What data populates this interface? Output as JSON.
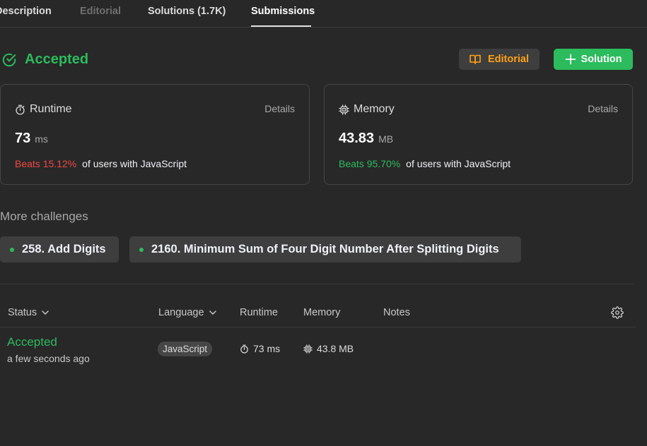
{
  "tabs": [
    {
      "label": "Description"
    },
    {
      "label": "Editorial"
    },
    {
      "label": "Solutions (1.7K)"
    },
    {
      "label": "Submissions"
    }
  ],
  "result": {
    "status": "Accepted",
    "status_color": "#2cbb5d",
    "editorial_button": "Editorial",
    "solution_button": "Solution"
  },
  "runtime_card": {
    "title": "Runtime",
    "details": "Details",
    "value": "73",
    "unit": "ms",
    "beats": "Beats 15.12%",
    "beats_suffix": "of users with JavaScript"
  },
  "memory_card": {
    "title": "Memory",
    "details": "Details",
    "value": "43.83",
    "unit": "MB",
    "beats": "Beats 95.70%",
    "beats_suffix": "of users with JavaScript"
  },
  "more_challenges": {
    "title": "More challenges",
    "items": [
      {
        "label": "258. Add Digits"
      },
      {
        "label": "2160. Minimum Sum of Four Digit Number After Splitting Digits"
      }
    ]
  },
  "table": {
    "headers": {
      "status": "Status",
      "language": "Language",
      "runtime": "Runtime",
      "memory": "Memory",
      "notes": "Notes"
    },
    "rows": [
      {
        "status": "Accepted",
        "time": "a few seconds ago",
        "language": "JavaScript",
        "runtime": "73 ms",
        "memory": "43.8 MB"
      }
    ]
  },
  "colors": {
    "accent_green": "#2cbb5d",
    "accent_orange": "#ffa116",
    "accent_red": "#ef4743",
    "background": "#282828"
  }
}
